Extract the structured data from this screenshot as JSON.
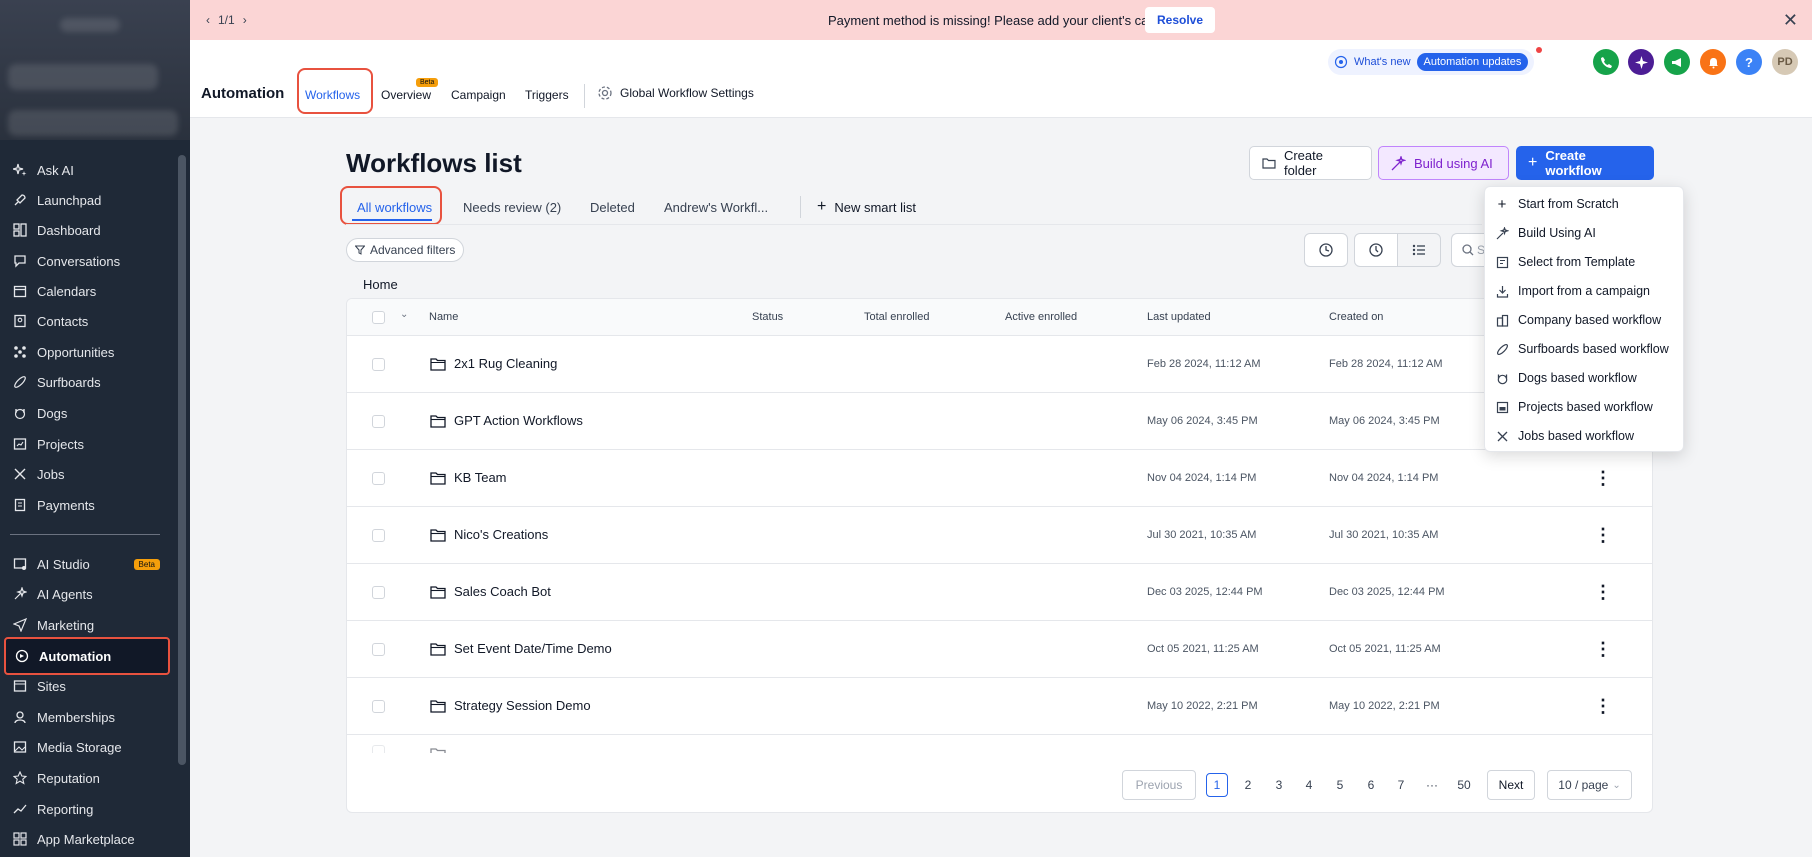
{
  "banner": {
    "pager": "1/1",
    "message": "Payment method is missing! Please add your client's card.",
    "resolve_label": "Resolve"
  },
  "sidebar": {
    "items": [
      {
        "label": "Ask AI",
        "icon": "sparkle-icon"
      },
      {
        "label": "Launchpad",
        "icon": "rocket-icon"
      },
      {
        "label": "Dashboard",
        "icon": "dashboard-icon"
      },
      {
        "label": "Conversations",
        "icon": "chat-icon"
      },
      {
        "label": "Calendars",
        "icon": "calendar-icon"
      },
      {
        "label": "Contacts",
        "icon": "contacts-icon"
      },
      {
        "label": "Opportunities",
        "icon": "opportunities-icon"
      },
      {
        "label": "Surfboards",
        "icon": "surfboard-icon"
      },
      {
        "label": "Dogs",
        "icon": "dog-icon"
      },
      {
        "label": "Projects",
        "icon": "projects-icon"
      },
      {
        "label": "Jobs",
        "icon": "tools-icon"
      },
      {
        "label": "Payments",
        "icon": "receipt-icon"
      },
      {
        "label": "AI Studio",
        "icon": "ai-studio-icon",
        "badge": "Beta"
      },
      {
        "label": "AI Agents",
        "icon": "ai-agents-icon"
      },
      {
        "label": "Marketing",
        "icon": "send-icon"
      },
      {
        "label": "Automation",
        "icon": "automation-icon"
      },
      {
        "label": "Sites",
        "icon": "sites-icon"
      },
      {
        "label": "Memberships",
        "icon": "memberships-icon"
      },
      {
        "label": "Media Storage",
        "icon": "image-icon"
      },
      {
        "label": "Reputation",
        "icon": "star-icon"
      },
      {
        "label": "Reporting",
        "icon": "trend-icon"
      },
      {
        "label": "App Marketplace",
        "icon": "grid-icon"
      }
    ]
  },
  "header": {
    "title": "Automation",
    "tabs": [
      "Workflows",
      "Overview",
      "Campaign",
      "Triggers"
    ],
    "overview_badge": "Beta",
    "global_settings": "Global Workflow Settings",
    "whats_new": "What's new",
    "automation_updates": "Automation updates",
    "avatar_initials": "PD",
    "help_label": "?"
  },
  "main": {
    "title": "Workflows list",
    "create_folder": "Create folder",
    "build_ai": "Build using AI",
    "create_workflow": "Create workflow",
    "tabs": [
      "All workflows",
      "Needs review (2)",
      "Deleted",
      "Andrew's Workfl..."
    ],
    "new_smart_list": "New smart list",
    "advanced_filters": "Advanced filters",
    "search_stub": "S",
    "breadcrumb": "Home"
  },
  "table": {
    "columns": [
      "Name",
      "Status",
      "Total enrolled",
      "Active enrolled",
      "Last updated",
      "Created on"
    ],
    "rows": [
      {
        "name": "2x1 Rug Cleaning",
        "updated": "Feb 28 2024, 11:12 AM",
        "created": "Feb 28 2024, 11:12 AM"
      },
      {
        "name": "GPT Action Workflows",
        "updated": "May 06 2024, 3:45 PM",
        "created": "May 06 2024, 3:45 PM"
      },
      {
        "name": "KB Team",
        "updated": "Nov 04 2024, 1:14 PM",
        "created": "Nov 04 2024, 1:14 PM"
      },
      {
        "name": "Nico's Creations",
        "updated": "Jul 30 2021, 10:35 AM",
        "created": "Jul 30 2021, 10:35 AM"
      },
      {
        "name": "Sales Coach Bot",
        "updated": "Dec 03 2025, 12:44 PM",
        "created": "Dec 03 2025, 12:44 PM"
      },
      {
        "name": "Set Event Date/Time Demo",
        "updated": "Oct 05 2021, 11:25 AM",
        "created": "Oct 05 2021, 11:25 AM"
      },
      {
        "name": "Strategy Session Demo",
        "updated": "May 10 2022, 2:21 PM",
        "created": "May 10 2022, 2:21 PM"
      }
    ]
  },
  "pagination": {
    "previous": "Previous",
    "pages": [
      "1",
      "2",
      "3",
      "4",
      "5",
      "6",
      "7",
      "···",
      "50"
    ],
    "current": "1",
    "next": "Next",
    "page_size": "10 / page"
  },
  "dropdown": {
    "items": [
      {
        "label": "Start from Scratch",
        "icon": "plus-icon"
      },
      {
        "label": "Build Using AI",
        "icon": "magic-wand-icon"
      },
      {
        "label": "Select from Template",
        "icon": "template-icon"
      },
      {
        "label": "Import from a campaign",
        "icon": "import-icon"
      },
      {
        "label": "Company based workflow",
        "icon": "company-icon"
      },
      {
        "label": "Surfboards based workflow",
        "icon": "surfboard-icon"
      },
      {
        "label": "Dogs based workflow",
        "icon": "dog-icon"
      },
      {
        "label": "Projects based workflow",
        "icon": "projects-icon"
      },
      {
        "label": "Jobs based workflow",
        "icon": "tools-icon"
      }
    ]
  },
  "colors": {
    "accent": "#2563eb",
    "highlight_outline": "#e8523f",
    "sidebar_bg": "#1f2937",
    "banner_bg": "#fbd5d5"
  }
}
